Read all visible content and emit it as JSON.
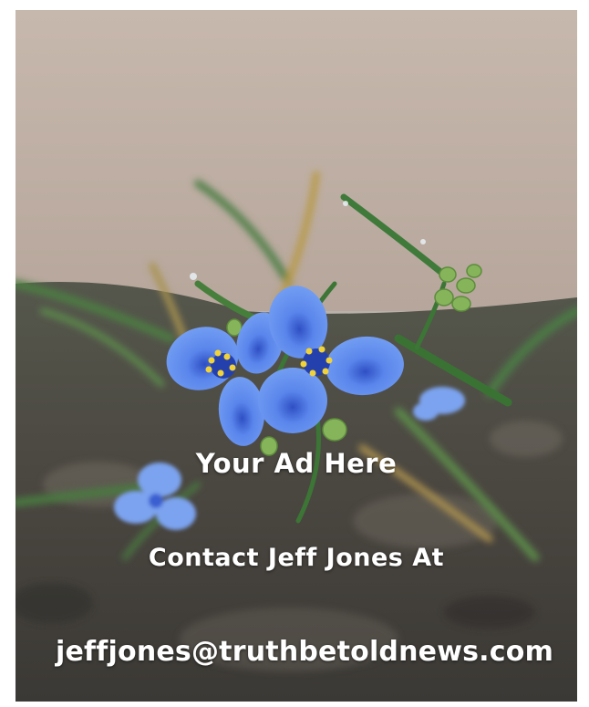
{
  "ad": {
    "headline": "Your Ad Here",
    "contact_line": "Contact Jeff Jones At",
    "email": "jeffjones@truthbetoldnews.com"
  },
  "photo": {
    "subject": "blue-flowers-photo",
    "colors": {
      "wall": "#c2b4aa",
      "petal": "#5b86e6",
      "stamen": "#f0d23a",
      "leaf": "#3f7a3a",
      "soil": "#4a4640"
    }
  }
}
